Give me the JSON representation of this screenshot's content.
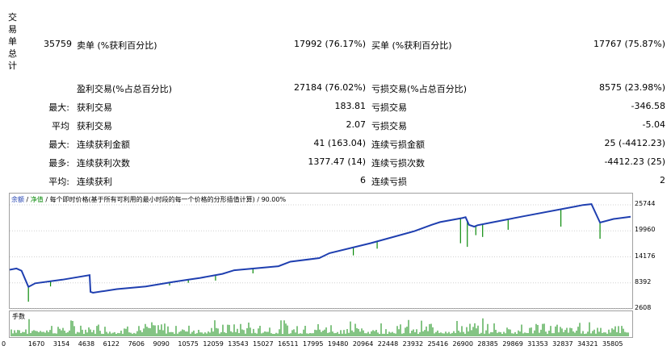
{
  "stats": {
    "side_label": [
      "交",
      "易",
      "单",
      "总",
      "计"
    ],
    "total_trades": "35759",
    "rows": [
      {
        "l1": "",
        "l2": "卖单 (%获利百分比)",
        "v1": "17992 (76.17%)",
        "l3": "买单 (%获利百分比)",
        "v2": "17767 (75.87%)"
      },
      {
        "l1": "",
        "l2": "盈利交易(%占总百分比)",
        "v1": "27184 (76.02%)",
        "l3": "亏损交易(%占总百分比)",
        "v2": "8575 (23.98%)"
      },
      {
        "l1": "最大:",
        "l2": "获利交易",
        "v1": "183.81",
        "l3": "亏损交易",
        "v2": "-346.58"
      },
      {
        "l1": "平均",
        "l2": "获利交易",
        "v1": "2.07",
        "l3": "亏损交易",
        "v2": "-5.04"
      },
      {
        "l1": "最大:",
        "l2": "连续获利金额",
        "v1": "41 (163.04)",
        "l3": "连续亏损金额",
        "v2": "25 (-4412.23)"
      },
      {
        "l1": "最多:",
        "l2": "连续获利次数",
        "v1": "1377.47 (14)",
        "l3": "连续亏损次数",
        "v2": "-4412.23 (25)"
      },
      {
        "l1": "平均:",
        "l2": "连续获利",
        "v1": "6",
        "l3": "连续亏损",
        "v2": "2"
      }
    ]
  },
  "chart": {
    "legend_balance": "余额",
    "legend_sep1": " / ",
    "legend_equity": "净值",
    "legend_rest": " / 每个即时价格(基于所有可利用的最小时段的每一个价格的分形插值计算) / 90.00%",
    "volume_label": "手数",
    "colors": {
      "balance": "#1f3fb0",
      "equity": "#0a8a0a",
      "grid": "#d0d0d0"
    }
  },
  "chart_data": {
    "type": "line",
    "title": "",
    "x_ticks": [
      "0",
      "1670",
      "3154",
      "4638",
      "6122",
      "7606",
      "9090",
      "10575",
      "12059",
      "13543",
      "15027",
      "16511",
      "17995",
      "19480",
      "20964",
      "22448",
      "23932",
      "25416",
      "26900",
      "28385",
      "29869",
      "31353",
      "32837",
      "34321",
      "35805"
    ],
    "y_ticks": [
      "25744",
      "19960",
      "14176",
      "8392",
      "2608"
    ],
    "ylim": [
      2608,
      25744
    ],
    "xlim": [
      0,
      36500
    ],
    "series": [
      {
        "name": "余额",
        "x": [
          0,
          400,
          700,
          1100,
          1500,
          3100,
          4700,
          4750,
          4900,
          6300,
          8000,
          9600,
          10500,
          11200,
          12500,
          13200,
          15800,
          16500,
          18200,
          18800,
          21200,
          23800,
          24800,
          25300,
          26600,
          26800,
          27000,
          27300,
          27500,
          28300,
          30200,
          33300,
          33700,
          34200,
          34700,
          35500,
          36500
        ],
        "y": [
          11300,
          11600,
          11100,
          7500,
          8300,
          9100,
          10100,
          6400,
          6200,
          7000,
          7600,
          8600,
          9100,
          9500,
          10400,
          11200,
          12100,
          13100,
          13900,
          15000,
          17200,
          19900,
          21300,
          21900,
          22800,
          23000,
          21300,
          20900,
          21200,
          21800,
          23200,
          25400,
          25700,
          25900,
          21800,
          22600,
          23100
        ]
      }
    ],
    "equity_dips": [
      {
        "x": 1100,
        "y": 4200
      },
      {
        "x": 2400,
        "y": 7600
      },
      {
        "x": 9400,
        "y": 7800
      },
      {
        "x": 10500,
        "y": 8400
      },
      {
        "x": 12100,
        "y": 8900
      },
      {
        "x": 14300,
        "y": 10500
      },
      {
        "x": 20200,
        "y": 14500
      },
      {
        "x": 21600,
        "y": 16000
      },
      {
        "x": 26500,
        "y": 17200
      },
      {
        "x": 26900,
        "y": 16400
      },
      {
        "x": 27400,
        "y": 19000
      },
      {
        "x": 27800,
        "y": 18600
      },
      {
        "x": 29300,
        "y": 20200
      },
      {
        "x": 32400,
        "y": 20900
      },
      {
        "x": 34700,
        "y": 18200
      }
    ]
  }
}
